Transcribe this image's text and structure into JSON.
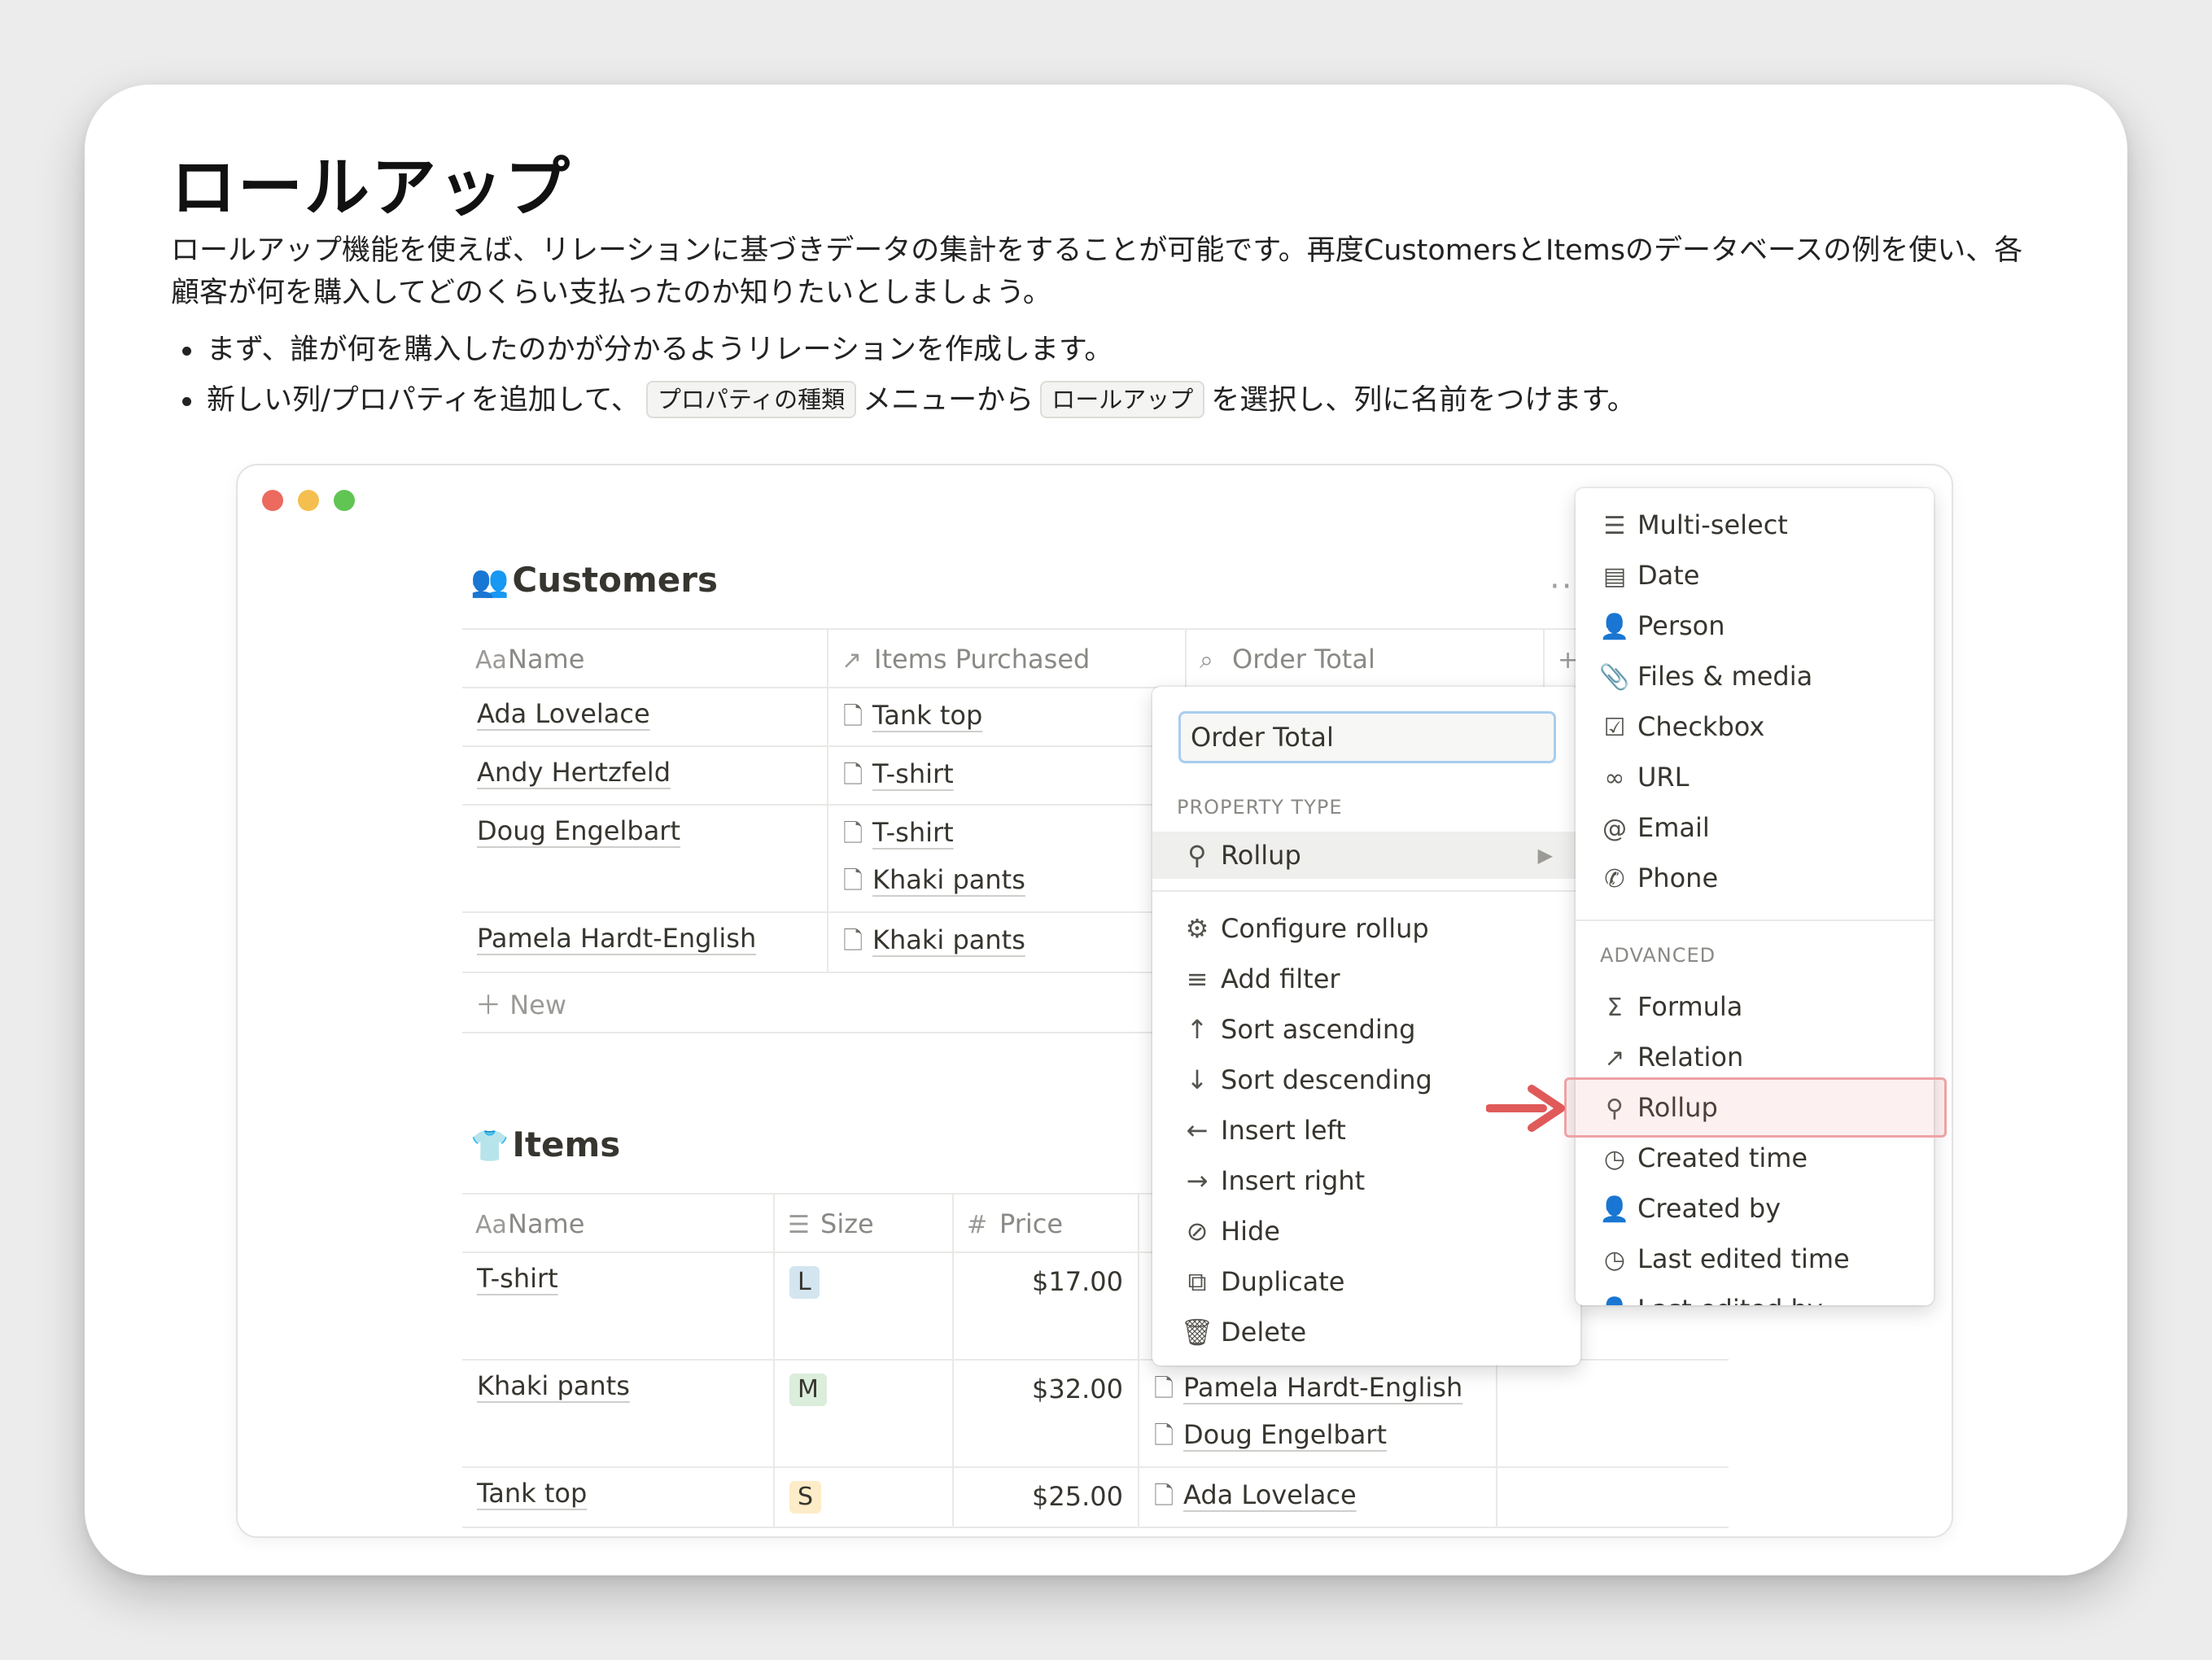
{
  "heading": "ロールアップ",
  "intro": "ロールアップ機能を使えば、リレーションに基づきデータの集計をすることが可能です。再度CustomersとItemsのデータベースの例を使い、各顧客が何を購入してどのくらい支払ったのか知りたいとしましょう。",
  "bullets": {
    "b1": "まず、誰が何を購入したのかが分かるようリレーションを作成します。",
    "b2_pre": "新しい列/プロパティを追加して、",
    "b2_code1": "プロパティの種類",
    "b2_mid": "メニューから",
    "b2_code2": "ロールアップ",
    "b2_post": "を選択し、列に名前をつけます。"
  },
  "colors": {
    "highlight": "#eea2a4",
    "arrow": "#e05a5a",
    "input_focus": "#a8cdef"
  },
  "customers": {
    "emoji": "👥",
    "title": "Customers",
    "more_icon": "···",
    "columns": [
      {
        "icon": "Aa",
        "label": "Name"
      },
      {
        "icon": "↗",
        "label": "Items Purchased"
      },
      {
        "icon": "⌕",
        "label": "Order Total"
      },
      {
        "icon": "+",
        "label": ""
      }
    ],
    "rows": [
      {
        "name": "Ada Lovelace",
        "items": [
          "Tank top"
        ]
      },
      {
        "name": "Andy Hertzfeld",
        "items": [
          "T-shirt"
        ]
      },
      {
        "name": "Doug Engelbart",
        "items": [
          "T-shirt",
          "Khaki pants"
        ]
      },
      {
        "name": "Pamela Hardt-English",
        "items": [
          "Khaki pants"
        ]
      }
    ],
    "new_label": "New"
  },
  "items": {
    "emoji": "👕",
    "title": "Items",
    "columns": [
      {
        "icon": "Aa",
        "label": "Name"
      },
      {
        "icon": "☰",
        "label": "Size"
      },
      {
        "icon": "#",
        "label": "Price"
      }
    ],
    "rows": [
      {
        "name": "T-shirt",
        "size": "L",
        "size_color": "#d3e5ef",
        "price": "$17.00",
        "customers": []
      },
      {
        "name": "Khaki pants",
        "size": "M",
        "size_color": "#dbeddb",
        "price": "$32.00",
        "customers": [
          "Pamela Hardt-English",
          "Doug Engelbart"
        ]
      },
      {
        "name": "Tank top",
        "size": "S",
        "size_color": "#fdecc8",
        "price": "$25.00",
        "customers": [
          "Ada Lovelace"
        ]
      }
    ]
  },
  "menu": {
    "input_value": "Order Total",
    "section_label": "PROPERTY TYPE",
    "type_item": {
      "icon": "search-icon",
      "label": "Rollup"
    },
    "actions": [
      {
        "icon": "gear-icon",
        "label": "Configure rollup"
      },
      {
        "icon": "filter-icon",
        "label": "Add filter"
      },
      {
        "icon": "arrow-up-icon",
        "label": "Sort ascending"
      },
      {
        "icon": "arrow-down-icon",
        "label": "Sort descending"
      },
      {
        "icon": "arrow-left-icon",
        "label": "Insert left"
      },
      {
        "icon": "arrow-right-icon",
        "label": "Insert right"
      },
      {
        "icon": "eye-off-icon",
        "label": "Hide"
      },
      {
        "icon": "duplicate-icon",
        "label": "Duplicate"
      },
      {
        "icon": "trash-icon",
        "label": "Delete"
      }
    ]
  },
  "submenu": {
    "basic": [
      {
        "icon": "list-icon",
        "label": "Multi-select"
      },
      {
        "icon": "calendar-icon",
        "label": "Date"
      },
      {
        "icon": "person-icon",
        "label": "Person"
      },
      {
        "icon": "paperclip-icon",
        "label": "Files & media"
      },
      {
        "icon": "checkbox-icon",
        "label": "Checkbox"
      },
      {
        "icon": "link-icon",
        "label": "URL"
      },
      {
        "icon": "at-icon",
        "label": "Email"
      },
      {
        "icon": "phone-icon",
        "label": "Phone"
      }
    ],
    "advanced_label": "ADVANCED",
    "advanced": [
      {
        "icon": "sigma-icon",
        "label": "Formula"
      },
      {
        "icon": "relation-arrow-icon",
        "label": "Relation"
      },
      {
        "icon": "search-icon",
        "label": "Rollup"
      },
      {
        "icon": "clock-icon",
        "label": "Created time"
      },
      {
        "icon": "person-icon",
        "label": "Created by"
      },
      {
        "icon": "clock-icon",
        "label": "Last edited time"
      },
      {
        "icon": "person-icon",
        "label": "Last edited by"
      }
    ]
  }
}
